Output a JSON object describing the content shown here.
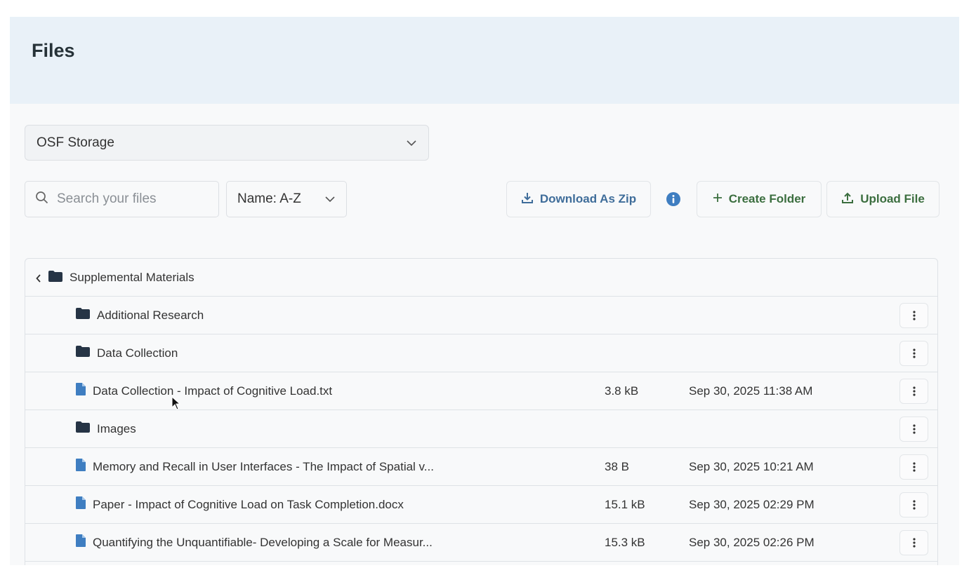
{
  "header": {
    "title": "Files"
  },
  "storage": {
    "selected": "OSF Storage"
  },
  "search": {
    "placeholder": "Search your files"
  },
  "sort": {
    "selected": "Name: A-Z"
  },
  "toolbar": {
    "download_zip_label": "Download As Zip",
    "create_folder_label": "Create Folder",
    "upload_file_label": "Upload File"
  },
  "tree": {
    "parent_folder": "Supplemental Materials",
    "items": [
      {
        "type": "folder",
        "name": "Additional Research",
        "size": "",
        "date": ""
      },
      {
        "type": "folder",
        "name": "Data Collection",
        "size": "",
        "date": ""
      },
      {
        "type": "file",
        "name": "Data Collection - Impact of Cognitive Load.txt",
        "size": "3.8 kB",
        "date": "Sep 30, 2025 11:38 AM"
      },
      {
        "type": "folder",
        "name": "Images",
        "size": "",
        "date": ""
      },
      {
        "type": "file",
        "name": "Memory and Recall in User Interfaces - The Impact of Spatial v...",
        "size": "38 B",
        "date": "Sep 30, 2025 10:21 AM"
      },
      {
        "type": "file",
        "name": "Paper - Impact of Cognitive Load on Task Completion.docx",
        "size": "15.1 kB",
        "date": "Sep 30, 2025 02:29 PM"
      },
      {
        "type": "file",
        "name": "Quantifying the Unquantifiable- Developing a Scale for Measur...",
        "size": "15.3 kB",
        "date": "Sep 30, 2025 02:26 PM"
      }
    ]
  },
  "colors": {
    "header_bg": "#e9f1f8",
    "folder_icon": "#263445",
    "file_icon": "#3f7ec1",
    "zip_button_text": "#3f6d9a",
    "action_button_text": "#3b6e3f",
    "info_icon": "#3f7ec1"
  }
}
